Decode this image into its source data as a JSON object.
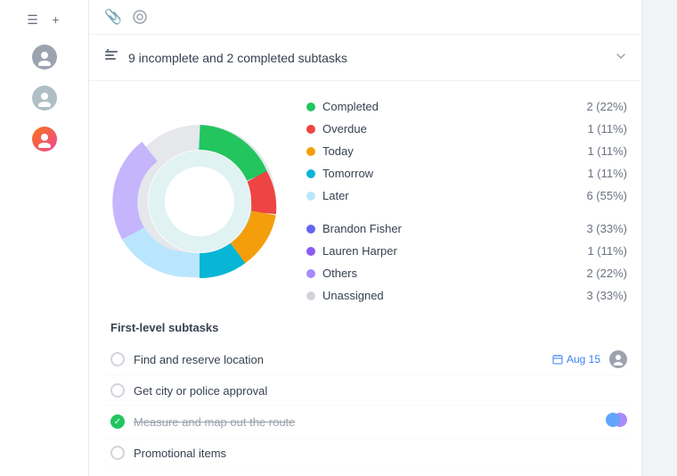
{
  "sidebar": {
    "icons": [
      "≡",
      "+"
    ],
    "avatars": [
      "U1",
      "U2",
      "U3"
    ]
  },
  "topbar": {
    "icons": [
      "📎",
      "◎"
    ]
  },
  "subtasks_header": {
    "icon": "≡",
    "title": "9 incomplete and 2 completed subtasks",
    "chevron": "∨"
  },
  "legend": {
    "status_items": [
      {
        "label": "Completed",
        "count": "2 (22%)",
        "color": "#22c55e"
      },
      {
        "label": "Overdue",
        "count": "1 (11%)",
        "color": "#ef4444"
      },
      {
        "label": "Today",
        "count": "1 (11%)",
        "color": "#f59e0b"
      },
      {
        "label": "Tomorrow",
        "count": "1 (11%)",
        "color": "#06b6d4"
      },
      {
        "label": "Later",
        "count": "6 (55%)",
        "color": "#bae6fd"
      }
    ],
    "person_items": [
      {
        "label": "Brandon Fisher",
        "count": "3 (33%)",
        "color": "#6366f1"
      },
      {
        "label": "Lauren Harper",
        "count": "1 (11%)",
        "color": "#8b5cf6"
      },
      {
        "label": "Others",
        "count": "2 (22%)",
        "color": "#a78bfa"
      },
      {
        "label": "Unassigned",
        "count": "3 (33%)",
        "color": "#d1d5db"
      }
    ]
  },
  "subtasks_section": {
    "title": "First-level subtasks",
    "items": [
      {
        "text": "Find and reserve location",
        "date": "Aug 15",
        "completed": false,
        "strikethrough": false,
        "has_avatar": true,
        "has_date": true
      },
      {
        "text": "Get city or police approval",
        "date": "",
        "completed": false,
        "strikethrough": false,
        "has_avatar": false,
        "has_date": false
      },
      {
        "text": "Measure and map out the route",
        "date": "",
        "completed": true,
        "strikethrough": true,
        "has_avatar": true,
        "has_date": false
      },
      {
        "text": "Promotional items",
        "date": "",
        "completed": false,
        "strikethrough": false,
        "has_avatar": false,
        "has_date": false
      }
    ]
  },
  "colors": {
    "completed": "#22c55e",
    "overdue": "#ef4444",
    "today": "#f59e0b",
    "tomorrow": "#06b6d4",
    "later_light": "#bae6fd",
    "later_purple": "#c4b5fd",
    "brandon": "#6366f1",
    "lauren": "#8b5cf6",
    "others": "#a78bfa",
    "unassigned": "#d1d5db"
  }
}
